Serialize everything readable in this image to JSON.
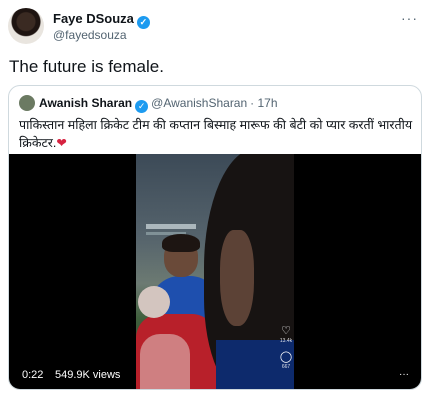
{
  "tweet": {
    "author_name": "Faye DSouza",
    "author_handle": "@fayedsouza",
    "text": "The future is female.",
    "verified_icon": "verified-badge-icon",
    "more_icon": "more-options-icon"
  },
  "quote": {
    "author_name": "Awanish Sharan",
    "author_handle": "@AwanishSharan",
    "time": "· 17h",
    "text": "पाकिस्तान महिला क्रिकेट टीम की कप्तान बिस्माह मारूफ की बेटी को प्यार करतीं भारतीय क्रिकेटर.",
    "emoji": "❤",
    "video": {
      "duration": "0:22",
      "views": "549.9K views",
      "like_count": "13.4k",
      "comment_count": "667"
    }
  },
  "colors": {
    "accent": "#1d9bf0",
    "text": "#0f1419",
    "muted": "#536471",
    "border": "#cfd9de"
  }
}
